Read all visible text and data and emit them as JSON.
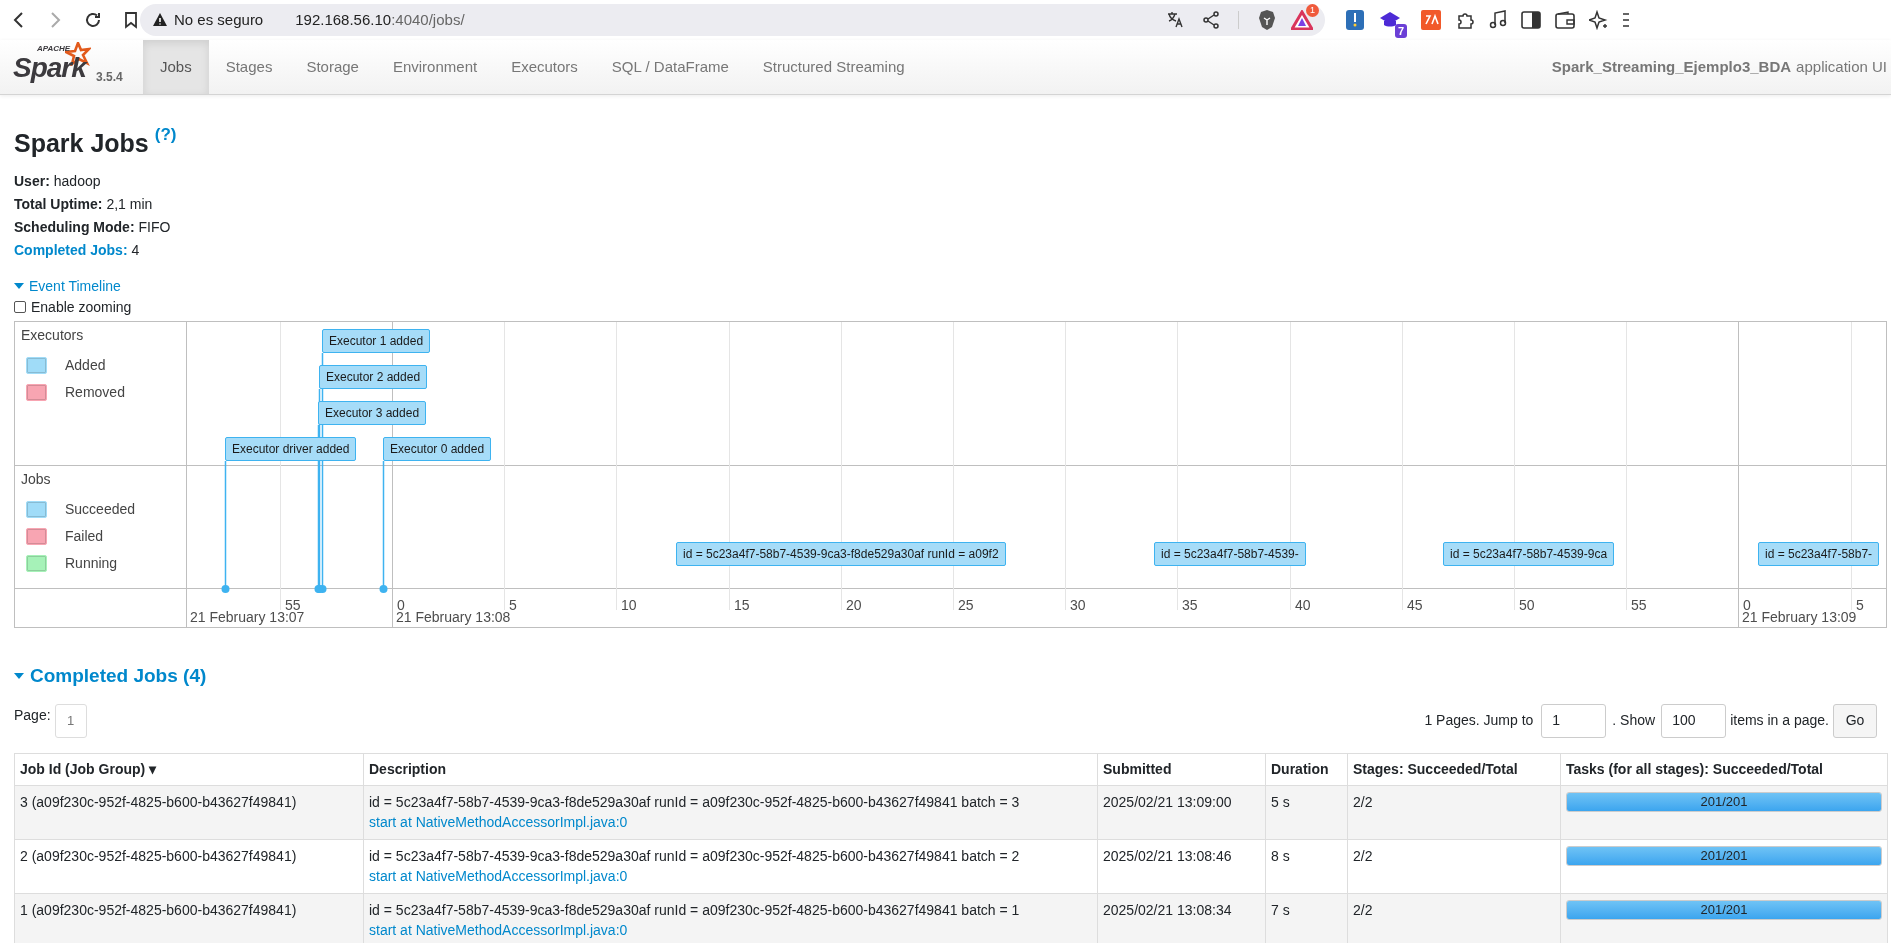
{
  "browser": {
    "security": "No es seguro",
    "url_host": "192.168.56.10",
    "url_rest": ":4040/jobs/",
    "badges": [
      "1",
      "7"
    ]
  },
  "logo": {
    "apache": "APACHE",
    "name": "Spark",
    "version": "3.5.4"
  },
  "nav": [
    {
      "label": "Jobs",
      "selected": true
    },
    {
      "label": "Stages",
      "selected": false
    },
    {
      "label": "Storage",
      "selected": false
    },
    {
      "label": "Environment",
      "selected": false
    },
    {
      "label": "Executors",
      "selected": false
    },
    {
      "label": "SQL / DataFrame",
      "selected": false
    },
    {
      "label": "Structured Streaming",
      "selected": false
    }
  ],
  "app": {
    "name": "Spark_Streaming_Ejemplo3_BDA",
    "suffix": "application UI"
  },
  "title": "Spark Jobs",
  "help": "(?)",
  "summary": [
    {
      "label": "User:",
      "value": "hadoop",
      "kind": "plain"
    },
    {
      "label": "Total Uptime:",
      "value": "2,1 min",
      "kind": "plain"
    },
    {
      "label": "Scheduling Mode:",
      "value": "FIFO",
      "kind": "plain"
    },
    {
      "label": "Completed Jobs:",
      "value": "4",
      "kind": "link"
    }
  ],
  "timeline_toggle": {
    "label": "Event Timeline",
    "expanded": true
  },
  "zoom_checkbox": {
    "label": "Enable zooming",
    "checked": false
  },
  "timeline": {
    "groups": [
      {
        "title": "Executors",
        "legend": [
          {
            "label": "Added",
            "color": "#a0dcf8"
          },
          {
            "label": "Removed",
            "color": "#f8a5b2"
          }
        ]
      },
      {
        "title": "Jobs",
        "legend": [
          {
            "label": "Succeeded",
            "color": "#a0dcf8"
          },
          {
            "label": "Failed",
            "color": "#f8a5b2"
          },
          {
            "label": "Running",
            "color": "#a6f2b8"
          }
        ]
      }
    ],
    "executor_events": [
      {
        "label": "Executor 1 added"
      },
      {
        "label": "Executor 2 added"
      },
      {
        "label": "Executor 3 added"
      },
      {
        "label": "Executor driver added"
      },
      {
        "label": "Executor 0 added"
      }
    ],
    "job_events": [
      {
        "label": "id = 5c23a4f7-58b7-4539-9ca3-f8de529a30af runId = a09f2"
      },
      {
        "label": "id = 5c23a4f7-58b7-4539-"
      },
      {
        "label": "id = 5c23a4f7-58b7-4539-9ca"
      },
      {
        "label": "id = 5c23a4f7-58b7-"
      }
    ],
    "ticks": [
      {
        "label": "55",
        "major": false
      },
      {
        "label": "0",
        "major": true
      },
      {
        "label": "5",
        "major": false
      },
      {
        "label": "10",
        "major": false
      },
      {
        "label": "15",
        "major": false
      },
      {
        "label": "20",
        "major": false
      },
      {
        "label": "25",
        "major": false
      },
      {
        "label": "30",
        "major": false
      },
      {
        "label": "35",
        "major": false
      },
      {
        "label": "40",
        "major": false
      },
      {
        "label": "45",
        "major": false
      },
      {
        "label": "50",
        "major": false
      },
      {
        "label": "55",
        "major": false
      },
      {
        "label": "0",
        "major": true
      },
      {
        "label": "5",
        "major": false
      }
    ],
    "dates": [
      "21 February 13:07",
      "21 February 13:08",
      "21 February 13:09"
    ]
  },
  "completed": {
    "title": "Completed Jobs (4)",
    "expanded": true
  },
  "pagination": {
    "page_label": "Page:",
    "page": "1",
    "pages_text": "1 Pages. Jump to",
    "jump": "1",
    "show_text": ". Show",
    "show": "100",
    "items_text": "items in a page.",
    "go": "Go"
  },
  "table": {
    "columns": [
      "Job Id (Job Group) ▾",
      "Description",
      "Submitted",
      "Duration",
      "Stages: Succeeded/Total",
      "Tasks (for all stages): Succeeded/Total"
    ],
    "rows": [
      {
        "job": "3 (a09f230c-952f-4825-b600-b43627f49841)",
        "description": "id = 5c23a4f7-58b7-4539-9ca3-f8de529a30af runId = a09f230c-952f-4825-b600-b43627f49841 batch = 3",
        "link": "start at NativeMethodAccessorImpl.java:0",
        "submitted": "2025/02/21 13:09:00",
        "duration": "5 s",
        "stages": "2/2",
        "tasks": "201/201",
        "level": 1
      },
      {
        "job": "2 (a09f230c-952f-4825-b600-b43627f49841)",
        "description": "id = 5c23a4f7-58b7-4539-9ca3-f8de529a30af runId = a09f230c-952f-4825-b600-b43627f49841 batch = 2",
        "link": "start at NativeMethodAccessorImpl.java:0",
        "submitted": "2025/02/21 13:08:46",
        "duration": "8 s",
        "stages": "2/2",
        "tasks": "201/201",
        "level": 1
      },
      {
        "job": "1 (a09f230c-952f-4825-b600-b43627f49841)",
        "description": "id = 5c23a4f7-58b7-4539-9ca3-f8de529a30af runId = a09f230c-952f-4825-b600-b43627f49841 batch = 1",
        "link": "start at NativeMethodAccessorImpl.java:0",
        "submitted": "2025/02/21 13:08:34",
        "duration": "7 s",
        "stages": "2/2",
        "tasks": "201/201",
        "level": 1
      }
    ]
  }
}
